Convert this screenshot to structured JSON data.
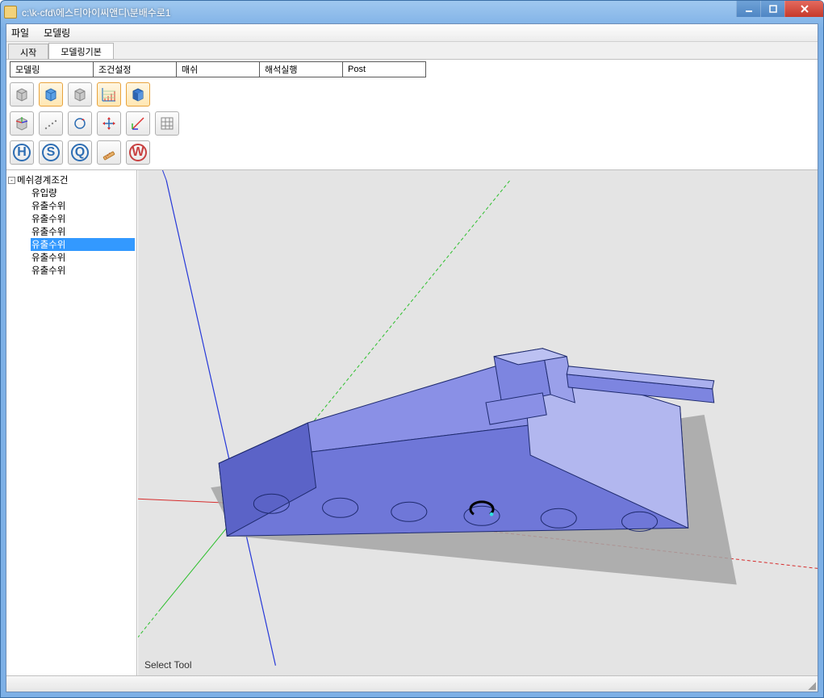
{
  "window": {
    "title": "c:\\k-cfd\\에스티아이씨앤디\\분배수로1"
  },
  "menubar": [
    "파일",
    "모델링"
  ],
  "workspace_tabs": {
    "items": [
      "시작",
      "모델링기본"
    ],
    "active_index": 1
  },
  "step_buttons": [
    "모델링",
    "조건설정",
    "매쉬",
    "해석실행",
    "Post"
  ],
  "toolbar_rows": [
    [
      {
        "name": "cube-gray-1-icon",
        "kind": "cube-gray"
      },
      {
        "name": "cube-blue-icon",
        "kind": "cube-blue",
        "highlight": true
      },
      {
        "name": "cube-gray-2-icon",
        "kind": "cube-gray"
      },
      {
        "name": "axes-grid-icon",
        "kind": "axes-grid",
        "highlight": true
      },
      {
        "name": "cube-blue-solid-icon",
        "kind": "cube-solid",
        "highlight": true
      }
    ],
    [
      {
        "name": "cube-with-axes-icon",
        "kind": "cube-axes"
      },
      {
        "name": "dots-icon",
        "kind": "dots"
      },
      {
        "name": "rotate-icon",
        "kind": "rotate"
      },
      {
        "name": "pan-icon",
        "kind": "pan"
      },
      {
        "name": "axis-tool-icon",
        "kind": "axis-tool"
      },
      {
        "name": "grid-icon",
        "kind": "grid"
      }
    ],
    [
      {
        "name": "h-button",
        "kind": "letter-H"
      },
      {
        "name": "s-button",
        "kind": "letter-S"
      },
      {
        "name": "q-button",
        "kind": "letter-Q"
      },
      {
        "name": "measure-icon",
        "kind": "measure"
      },
      {
        "name": "w-button",
        "kind": "letter-W"
      }
    ]
  ],
  "tree": {
    "root_label": "메쉬경계조건",
    "children": [
      {
        "label": "유입량",
        "selected": false
      },
      {
        "label": "유출수위",
        "selected": false
      },
      {
        "label": "유출수위",
        "selected": false
      },
      {
        "label": "유출수위",
        "selected": false
      },
      {
        "label": "유출수위",
        "selected": true
      },
      {
        "label": "유출수위",
        "selected": false
      },
      {
        "label": "유출수위",
        "selected": false
      }
    ]
  },
  "viewport": {
    "status_text": "Select Tool",
    "axes": {
      "x": "red",
      "y": "green",
      "z": "blue"
    },
    "model_color": "#7d85e0"
  }
}
